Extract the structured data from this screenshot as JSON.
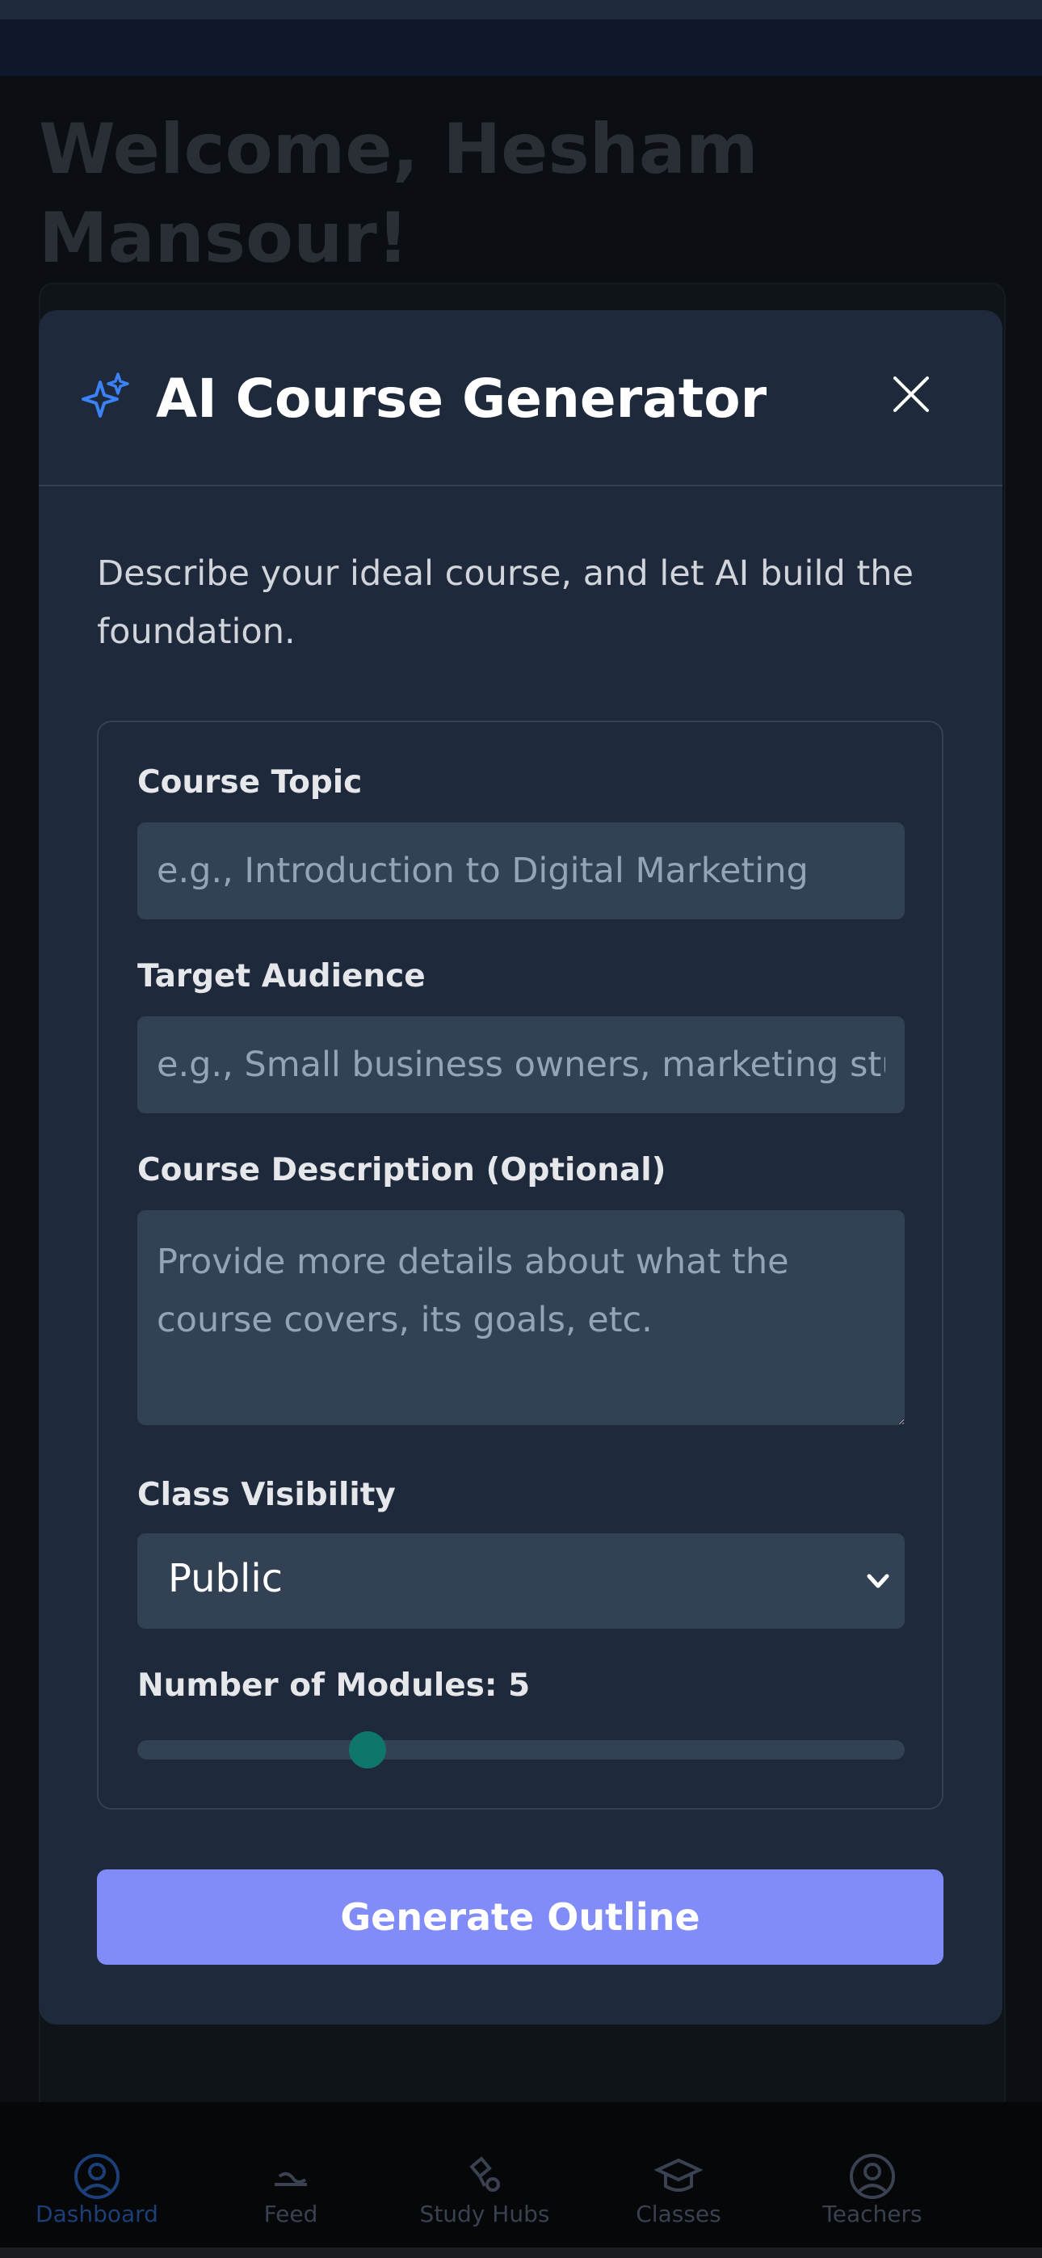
{
  "page": {
    "welcome": "Welcome, Hesham Mansour!"
  },
  "modal": {
    "title": "AI Course Generator",
    "intro": "Describe your ideal course, and let AI build the foundation.",
    "fields": {
      "topic_label": "Course Topic",
      "topic_placeholder": "e.g., Introduction to Digital Marketing",
      "topic_value": "",
      "audience_label": "Target Audience",
      "audience_placeholder": "e.g., Small business owners, marketing students",
      "audience_value": "",
      "description_label": "Course Description (Optional)",
      "description_placeholder": "Provide more details about what the course covers, its goals, etc.",
      "description_value": "",
      "visibility_label": "Class Visibility",
      "visibility_value": "Public",
      "modules_label": "Number of Modules: 5",
      "modules_value": 5,
      "modules_fill_fraction": 0.3
    },
    "generate_label": "Generate Outline"
  },
  "nav": {
    "items": [
      {
        "label": "Dashboard",
        "icon": "user-circle-icon",
        "active": true
      },
      {
        "label": "Feed",
        "icon": "feed-icon",
        "active": false
      },
      {
        "label": "Study Hubs",
        "icon": "study-hubs-icon",
        "active": false
      },
      {
        "label": "Classes",
        "icon": "graduation-cap-icon",
        "active": false
      },
      {
        "label": "Teachers",
        "icon": "user-circle-icon",
        "active": false
      }
    ]
  },
  "colors": {
    "modal_bg": "#1e293b",
    "input_bg": "#334155",
    "accent_button": "#818cf8",
    "slider_thumb": "#0f766e",
    "sparkle": "#3b82f6",
    "nav_active": "#1d3f77"
  }
}
